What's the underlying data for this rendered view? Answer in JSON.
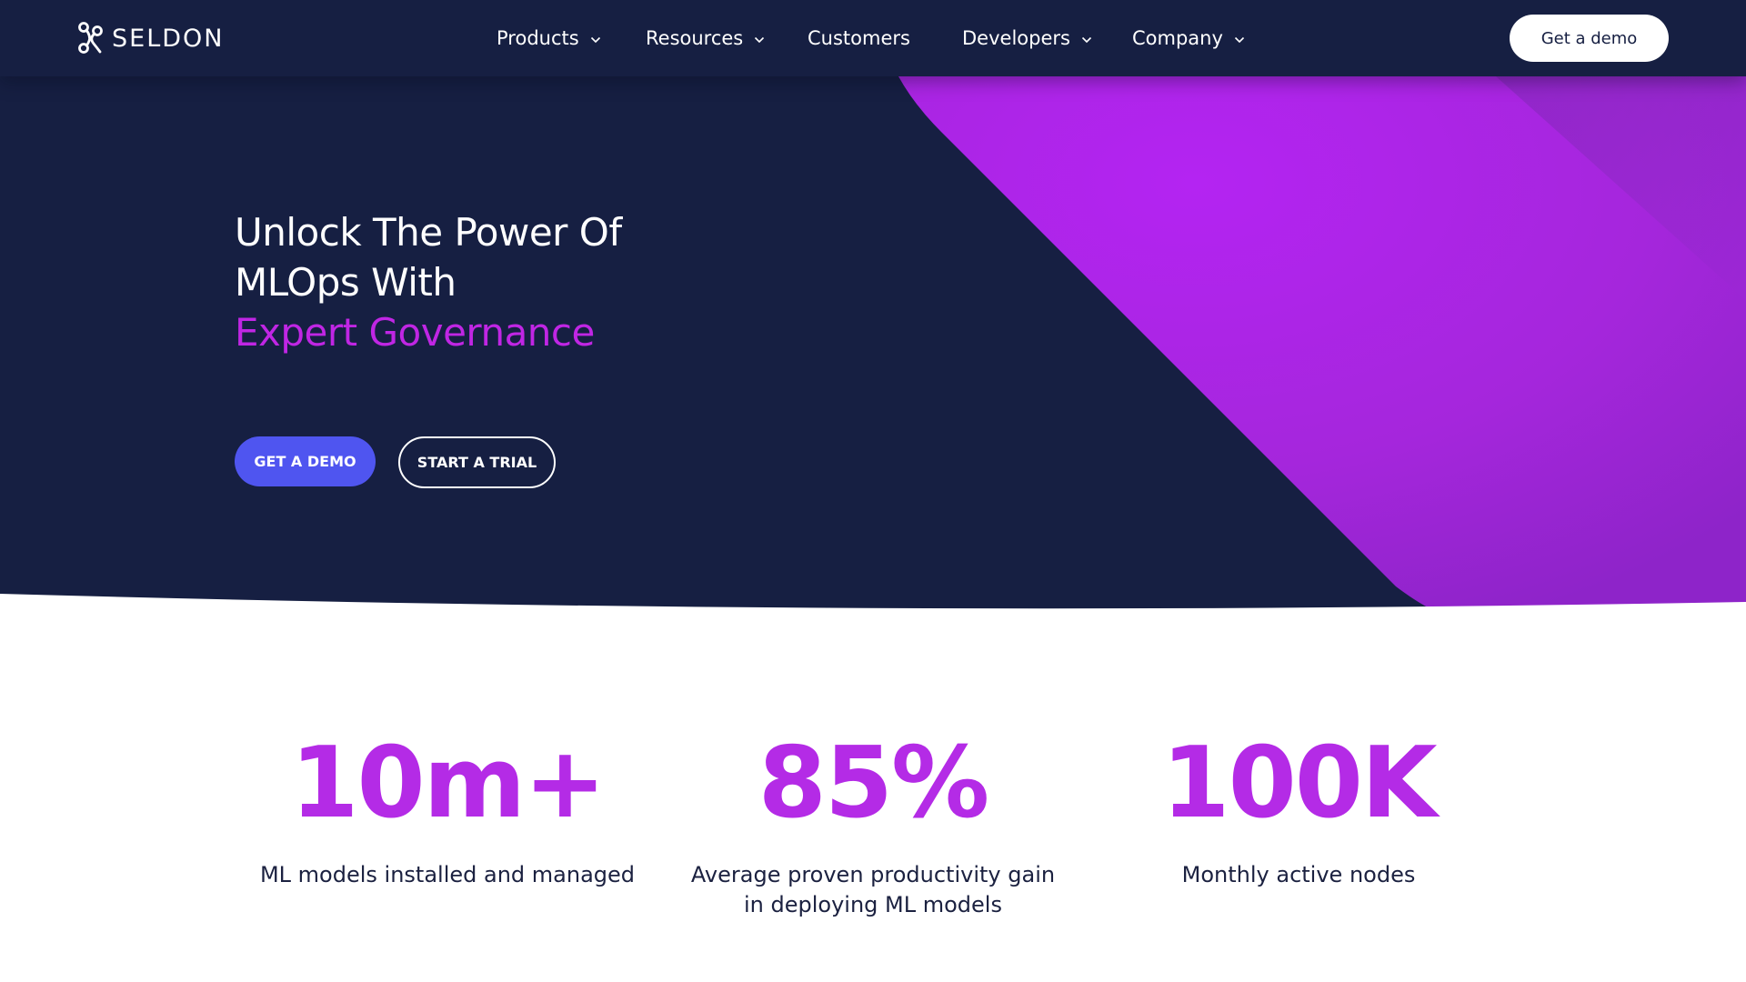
{
  "header": {
    "brand": "SELDON",
    "nav": [
      {
        "label": "Products",
        "has_dropdown": true
      },
      {
        "label": "Resources",
        "has_dropdown": true
      },
      {
        "label": "Customers",
        "has_dropdown": false
      },
      {
        "label": "Developers",
        "has_dropdown": true
      },
      {
        "label": "Company",
        "has_dropdown": true
      }
    ],
    "cta_label": "Get a demo"
  },
  "hero": {
    "title_line_1": "Unlock The Power Of",
    "title_line_2": "MLOps With",
    "title_accent": "Expert Governance",
    "primary_button": "GET A DEMO",
    "secondary_button": "START A TRIAL"
  },
  "stats": [
    {
      "value": "10m+",
      "label": "ML models installed and managed"
    },
    {
      "value": "85%",
      "label": "Average proven productivity gain in deploying ML models"
    },
    {
      "value": "100K",
      "label": "Monthly active nodes"
    }
  ],
  "colors": {
    "navy": "#161f42",
    "accent_purple": "#b42be6",
    "primary_blue": "#4f55f0",
    "white": "#ffffff"
  }
}
